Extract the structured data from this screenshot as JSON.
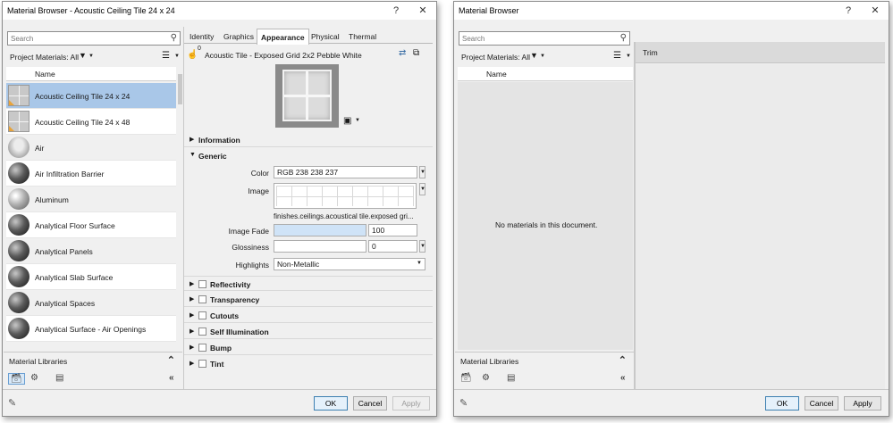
{
  "left": {
    "title": "Material Browser - Acoustic Ceiling Tile 24 x 24",
    "help": "?",
    "close": "✕",
    "search_placeholder": "Search",
    "project_materials": "Project Materials: All",
    "name_header": "Name",
    "materials": [
      {
        "name": "Acoustic Ceiling Tile 24 x 24",
        "icon": "ceiling-tile"
      },
      {
        "name": "Acoustic Ceiling Tile 24 x 48",
        "icon": "ceiling-tile"
      },
      {
        "name": "Air",
        "icon": "air"
      },
      {
        "name": "Air Infiltration Barrier",
        "icon": "sphere-dark"
      },
      {
        "name": "Aluminum",
        "icon": "sphere-light"
      },
      {
        "name": "Analytical Floor Surface",
        "icon": "sphere-dark"
      },
      {
        "name": "Analytical Panels",
        "icon": "sphere-dark"
      },
      {
        "name": "Analytical Slab Surface",
        "icon": "sphere-dark"
      },
      {
        "name": "Analytical Spaces",
        "icon": "sphere-dark"
      },
      {
        "name": "Analytical Surface - Air Openings",
        "icon": "sphere-dark"
      }
    ],
    "material_libraries": "Material Libraries",
    "tabs": [
      "Identity",
      "Graphics",
      "Appearance",
      "Physical",
      "Thermal"
    ],
    "active_tab": "Appearance",
    "asset_name": "Acoustic Tile - Exposed Grid 2x2 Pebble White",
    "asset_count": "0",
    "sections": {
      "information": "Information",
      "generic": "Generic",
      "reflectivity": "Reflectivity",
      "transparency": "Transparency",
      "cutouts": "Cutouts",
      "self_illumination": "Self Illumination",
      "bump": "Bump",
      "tint": "Tint"
    },
    "props": {
      "color_label": "Color",
      "color_value": "RGB 238 238 237",
      "image_label": "Image",
      "image_path": "finishes.ceilings.acoustical tile.exposed gri...",
      "image_fade_label": "Image Fade",
      "image_fade_value": "100",
      "image_fade_level": 1.0,
      "glossiness_label": "Glossiness",
      "glossiness_value": "0",
      "glossiness_level": 0.0,
      "highlights_label": "Highlights",
      "highlights_value": "Non-Metallic"
    },
    "buttons": {
      "ok": "OK",
      "cancel": "Cancel",
      "apply": "Apply"
    }
  },
  "right": {
    "title": "Material Browser",
    "help": "?",
    "close": "✕",
    "search_placeholder": "Search",
    "project_materials": "Project Materials: All",
    "name_header": "Name",
    "empty_message": "No materials in this document.",
    "trim_label": "Trim",
    "material_libraries": "Material Libraries",
    "buttons": {
      "ok": "OK",
      "cancel": "Cancel",
      "apply": "Apply"
    }
  },
  "colors": {
    "selected_row": "#a9c7e8",
    "image_fade_fill": "#cfe3f7",
    "ok_border": "#3c7fb1"
  }
}
